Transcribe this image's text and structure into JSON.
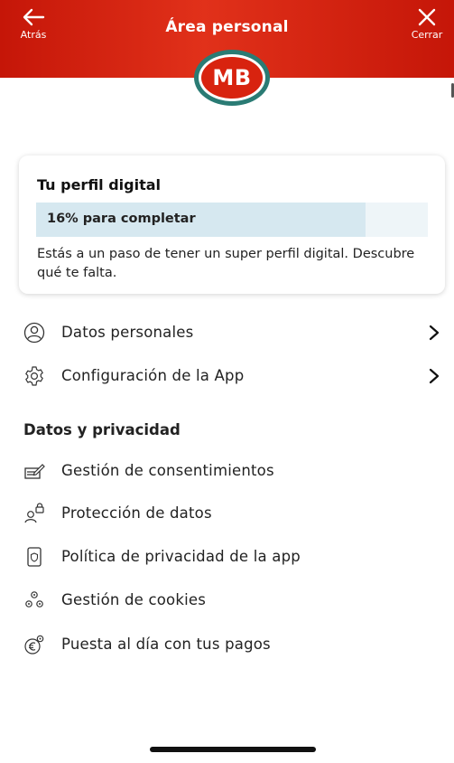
{
  "header": {
    "back_label": "Atrás",
    "title": "Área personal",
    "close_label": "Cerrar"
  },
  "avatar": {
    "initials": "MB"
  },
  "profile_card": {
    "title": "Tu perfil digital",
    "progress_label": "16% para completar",
    "progress_fraction": 0.84,
    "description": "Estás a un paso de tener un super perfil digital. Descubre qué te falta."
  },
  "menu": {
    "items": [
      {
        "label": "Datos personales",
        "icon": "person-circle-icon"
      },
      {
        "label": "Configuración de la App",
        "icon": "gear-icon"
      }
    ]
  },
  "privacy": {
    "section_title": "Datos y privacidad",
    "items": [
      {
        "label": "Gestión de consentimientos",
        "icon": "consent-document-icon"
      },
      {
        "label": "Protección de datos",
        "icon": "person-lock-icon"
      },
      {
        "label": "Política de privacidad de la app",
        "icon": "phone-shield-icon"
      },
      {
        "label": "Gestión de cookies",
        "icon": "cookies-gears-icon"
      },
      {
        "label": "Puesta al día con tus pagos",
        "icon": "euro-settings-icon"
      }
    ]
  },
  "colors": {
    "brand_red": "#d8230f",
    "avatar_ring": "#2a7b74",
    "progress_track": "#eef5f8",
    "progress_fill": "#d6e8f0"
  }
}
